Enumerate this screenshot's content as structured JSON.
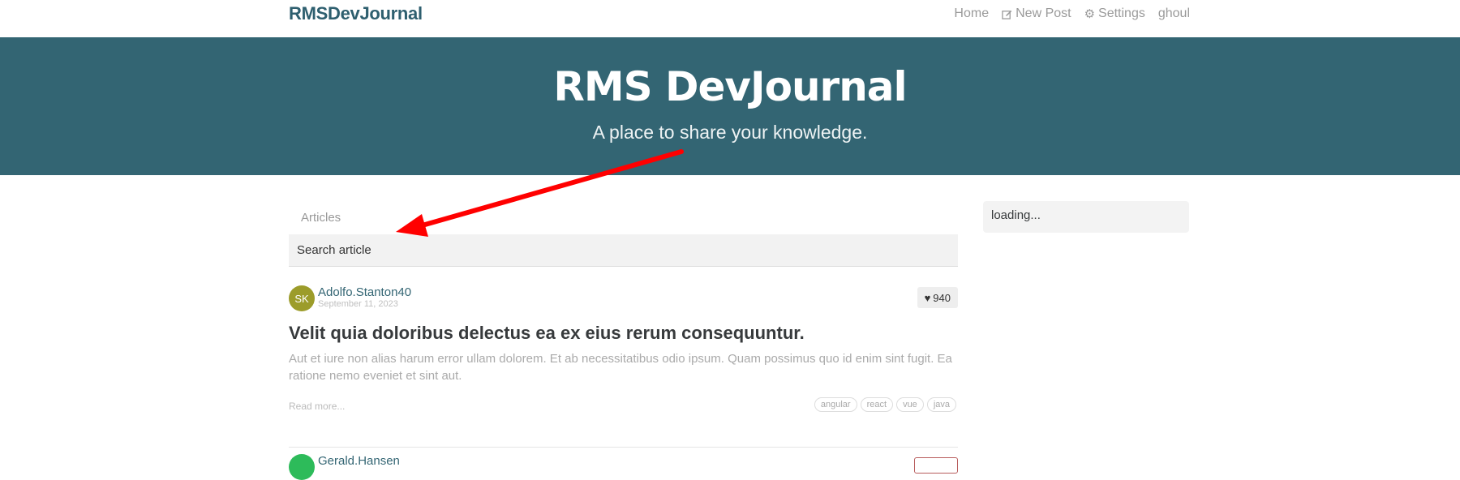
{
  "nav": {
    "brand": "RMSDevJournal",
    "links": [
      {
        "label": "Home",
        "icon": ""
      },
      {
        "label": "New Post",
        "icon": "edit-icon"
      },
      {
        "label": "Settings",
        "icon": "gear-icon"
      },
      {
        "label": "ghoul",
        "icon": ""
      }
    ]
  },
  "banner": {
    "title": "RMS DevJournal",
    "subtitle": "A place to share your knowledge."
  },
  "feed": {
    "tab_label": "Articles",
    "search_placeholder": "Search article"
  },
  "articles": [
    {
      "avatar_initials": "SK",
      "avatar_color": "#9c9c2a",
      "author": "Adolfo.Stanton40",
      "date": "September 11, 2023",
      "likes": "940",
      "title": "Velit quia doloribus delectus ea ex eius rerum consequuntur.",
      "description": "Aut et iure non alias harum error ullam dolorem. Et ab necessitatibus odio ipsum. Quam possimus quo id enim sint fugit. Ea ratione nemo eveniet et sint aut.",
      "read_more": "Read more...",
      "tags": [
        "angular",
        "react",
        "vue",
        "java"
      ]
    },
    {
      "avatar_color": "#2dbb5a",
      "author": "Gerald.Hansen"
    }
  ],
  "sidebar": {
    "status": "loading..."
  },
  "annotation": {
    "arrow_color": "#ff0000"
  }
}
